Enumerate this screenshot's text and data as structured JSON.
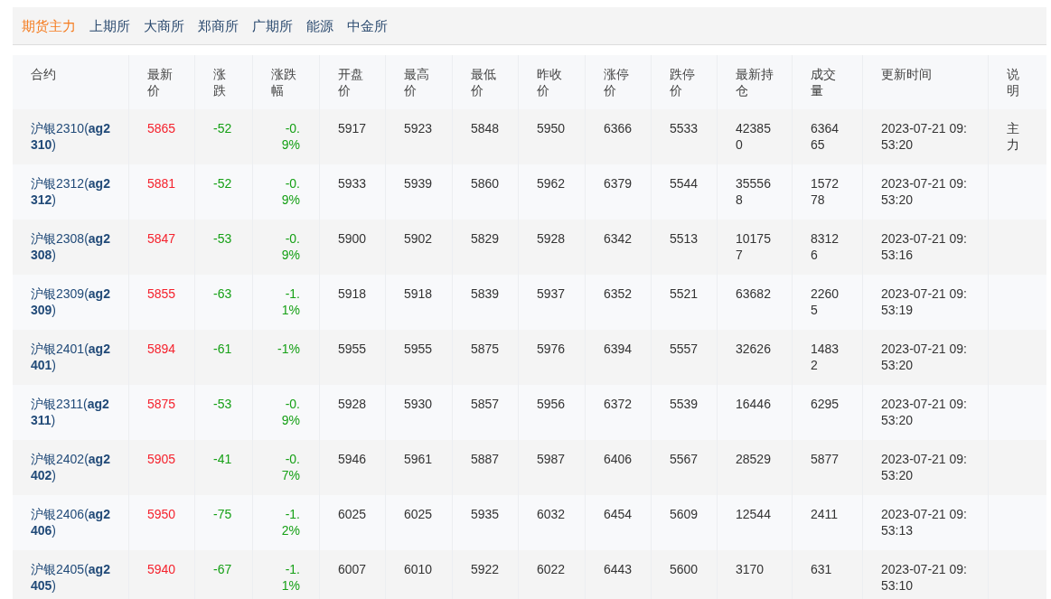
{
  "tabs": [
    {
      "label": "期货主力",
      "selected": true
    },
    {
      "label": "上期所",
      "selected": false
    },
    {
      "label": "大商所",
      "selected": false
    },
    {
      "label": "郑商所",
      "selected": false
    },
    {
      "label": "广期所",
      "selected": false
    },
    {
      "label": "能源",
      "selected": false
    },
    {
      "label": "中金所",
      "selected": false
    }
  ],
  "table": {
    "columns": [
      "合约",
      "最新价",
      "涨跌",
      "涨跌幅",
      "开盘价",
      "最高价",
      "最低价",
      "昨收价",
      "涨停价",
      "跌停价",
      "最新持仓",
      "成交量",
      "更新时间",
      "说明"
    ],
    "rows": [
      {
        "contract": "沪银2310(**ag2310**)",
        "last": "5865",
        "change": "-52",
        "change_pct": "-0.9%",
        "open": "5917",
        "high": "5923",
        "low": "5848",
        "prev_close": "5950",
        "limit_up": "6366",
        "limit_down": "5533",
        "open_interest": "423850",
        "volume": "636465",
        "updated": "2023-07-21 09:53:20",
        "note": "主力"
      },
      {
        "contract": "沪银2312(**ag2312**)",
        "last": "5881",
        "change": "-52",
        "change_pct": "-0.9%",
        "open": "5933",
        "high": "5939",
        "low": "5860",
        "prev_close": "5962",
        "limit_up": "6379",
        "limit_down": "5544",
        "open_interest": "355568",
        "volume": "157278",
        "updated": "2023-07-21 09:53:20"
      },
      {
        "contract": "沪银2308(**ag2308**)",
        "last": "5847",
        "change": "-53",
        "change_pct": "-0.9%",
        "open": "5900",
        "high": "5902",
        "low": "5829",
        "prev_close": "5928",
        "limit_up": "6342",
        "limit_down": "5513",
        "open_interest": "101757",
        "volume": "83126",
        "updated": "2023-07-21 09:53:16"
      },
      {
        "contract": "沪银2309(**ag2309**)",
        "last": "5855",
        "change": "-63",
        "change_pct": "-1.1%",
        "open": "5918",
        "high": "5918",
        "low": "5839",
        "prev_close": "5937",
        "limit_up": "6352",
        "limit_down": "5521",
        "open_interest": "63682",
        "volume": "22605",
        "updated": "2023-07-21 09:53:19"
      },
      {
        "contract": "沪银2401(**ag2401**)",
        "last": "5894",
        "change": "-61",
        "change_pct": "-1%",
        "open": "5955",
        "high": "5955",
        "low": "5875",
        "prev_close": "5976",
        "limit_up": "6394",
        "limit_down": "5557",
        "open_interest": "32626",
        "volume": "14832",
        "updated": "2023-07-21 09:53:20"
      },
      {
        "contract": "沪银2311(**ag2311**)",
        "last": "5875",
        "change": "-53",
        "change_pct": "-0.9%",
        "open": "5928",
        "high": "5930",
        "low": "5857",
        "prev_close": "5956",
        "limit_up": "6372",
        "limit_down": "5539",
        "open_interest": "16446",
        "volume": "6295",
        "updated": "2023-07-21 09:53:20"
      },
      {
        "contract": "沪银2402(**ag2402**)",
        "last": "5905",
        "change": "-41",
        "change_pct": "-0.7%",
        "open": "5946",
        "high": "5961",
        "low": "5887",
        "prev_close": "5987",
        "limit_up": "6406",
        "limit_down": "5567",
        "open_interest": "28529",
        "volume": "5877",
        "updated": "2023-07-21 09:53:20"
      },
      {
        "contract": "沪银2406(**ag2406**)",
        "last": "5950",
        "change": "-75",
        "change_pct": "-1.2%",
        "open": "6025",
        "high": "6025",
        "low": "5935",
        "prev_close": "6032",
        "limit_up": "6454",
        "limit_down": "5609",
        "open_interest": "12544",
        "volume": "2411",
        "updated": "2023-07-21 09:53:13"
      },
      {
        "contract": "沪银2405(**ag2405**)",
        "last": "5940",
        "change": "-67",
        "change_pct": "-1.1%",
        "open": "6007",
        "high": "6010",
        "low": "5922",
        "prev_close": "6022",
        "limit_up": "6443",
        "limit_down": "5600",
        "open_interest": "3170",
        "volume": "631",
        "updated": "2023-07-21 09:53:10"
      }
    ]
  }
}
